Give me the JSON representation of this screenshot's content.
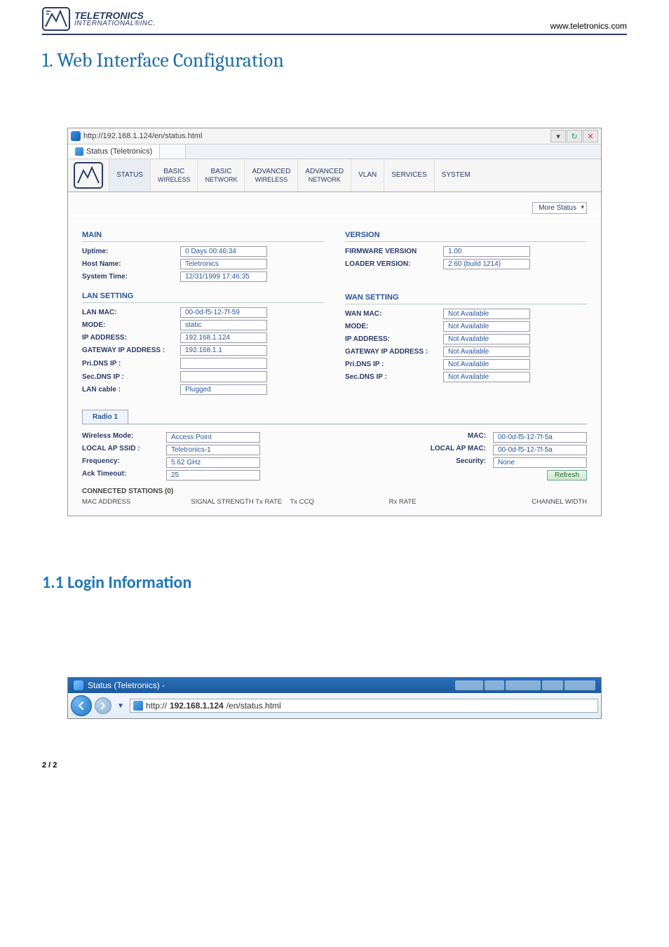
{
  "header": {
    "logo_line1": "TELETRONICS",
    "logo_line2": "INTERNATIONAL®INC.",
    "site_url": "www.teletronics.com"
  },
  "titles": {
    "main": "1. Web Interface Configuration",
    "sub": "1.1 Login Information"
  },
  "browser": {
    "url": "http://192.168.1.124/en/status.html",
    "tab": "Status (Teletronics)",
    "controls": {
      "dd": "▾",
      "search": "↻",
      "close": "✕"
    }
  },
  "nav": [
    {
      "l1": "STATUS",
      "l2": ""
    },
    {
      "l1": "BASIC",
      "l2": "WIRELESS"
    },
    {
      "l1": "BASIC",
      "l2": "NETWORK"
    },
    {
      "l1": "ADVANCED",
      "l2": "WIRELESS"
    },
    {
      "l1": "ADVANCED",
      "l2": "NETWORK"
    },
    {
      "l1": "VLAN",
      "l2": ""
    },
    {
      "l1": "SERVICES",
      "l2": ""
    },
    {
      "l1": "SYSTEM",
      "l2": ""
    }
  ],
  "more_status": "More Status",
  "groups": {
    "main": {
      "title": "MAIN",
      "uptime_k": "Uptime:",
      "uptime_v": "0 Days 00:46:34",
      "host_k": "Host Name:",
      "host_v": "Teletronics",
      "time_k": "System Time:",
      "time_v": "12/31/1999 17:46:35"
    },
    "version": {
      "title": "VERSION",
      "fw_k": "FIRMWARE VERSION",
      "fw_v": "1.00",
      "ld_k": "LOADER VERSION:",
      "ld_v": "2.60 (build 1214)"
    },
    "lan": {
      "title": "LAN SETTING",
      "mac_k": "LAN MAC:",
      "mac_v": "00-0d-f5-12-7f-59",
      "mode_k": "MODE:",
      "mode_v": "static",
      "ip_k": "IP ADDRESS:",
      "ip_v": "192.168.1.124",
      "gw_k": "GATEWAY IP ADDRESS :",
      "gw_v": "192.168.1.1",
      "pdns_k": "Pri.DNS IP :",
      "pdns_v": "",
      "sdns_k": "Sec.DNS IP :",
      "sdns_v": "",
      "cable_k": "LAN cable :",
      "cable_v": "Plugged"
    },
    "wan": {
      "title": "WAN SETTING",
      "mac_k": "WAN MAC:",
      "mac_v": "Not Available",
      "mode_k": "MODE:",
      "mode_v": "Not Available",
      "ip_k": "IP ADDRESS:",
      "ip_v": "Not Available",
      "gw_k": "GATEWAY IP ADDRESS :",
      "gw_v": "Not Available",
      "pdns_k": "Pri.DNS IP :",
      "pdns_v": "Not Available",
      "sdns_k": "Sec.DNS IP :",
      "sdns_v": "Not Available"
    }
  },
  "radio": {
    "tab": "Radio 1",
    "rows": [
      {
        "k": "Wireless Mode:",
        "v": "Access Point",
        "k2": "MAC:",
        "v2": "00-0d-f5-12-7f-5a"
      },
      {
        "k": "LOCAL AP SSID :",
        "v": "Teletronics-1",
        "k2": "LOCAL AP MAC:",
        "v2": "00-0d-f5-12-7f-5a"
      },
      {
        "k": "Frequency:",
        "v": "5.62 GHz",
        "k2": "Security:",
        "v2": "None"
      },
      {
        "k": "Ack Timeout:",
        "v": "25",
        "k2": "",
        "v2btn": "Refresh"
      }
    ],
    "conn_title": "CONNECTED STATIONS (0)",
    "conn_cols": [
      "MAC ADDRESS",
      "SIGNAL STRENGTH Tx RATE",
      "Tx CCQ",
      "Rx RATE",
      "CHANNEL WIDTH"
    ]
  },
  "minibar": {
    "title": "Status (Teletronics) -",
    "proto": "http://",
    "host": "192.168.1.124",
    "path": "/en/status.html"
  },
  "page_num": "2 / 2"
}
